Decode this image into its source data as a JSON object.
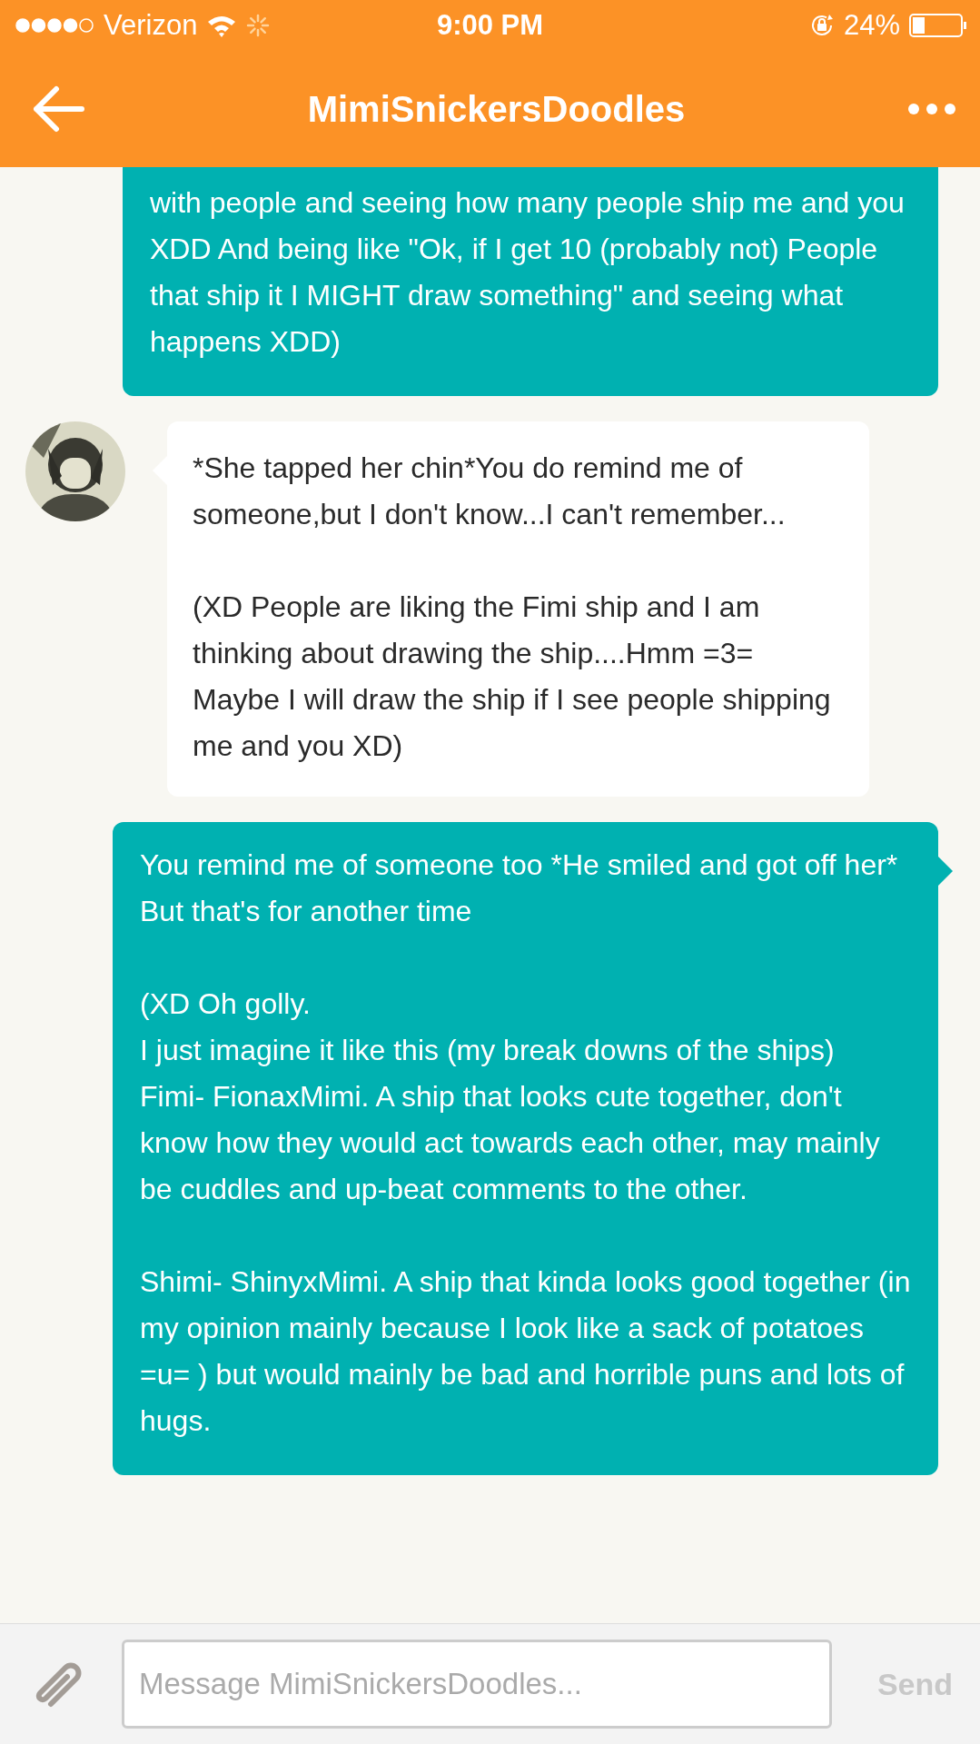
{
  "status_bar": {
    "carrier": "Verizon",
    "time": "9:00 PM",
    "battery": "24%"
  },
  "header": {
    "title": "MimiSnickersDoodles"
  },
  "messages": [
    {
      "kind": "sent",
      "text": "with people and seeing how many people ship me and you XDD And being like \"Ok, if I get 10 (probably not) People that ship it I MIGHT draw something\" and seeing what happens XDD)"
    },
    {
      "kind": "received",
      "text": "*She tapped her chin*You do remind me of someone,but I don't know...I can't remember...\n\n(XD People are liking the Fimi ship and I am thinking about drawing the ship....Hmm =3= Maybe I will draw the ship if I see people shipping me and you XD)"
    },
    {
      "kind": "sent",
      "text": "You remind me of someone too *He smiled and got off her* But that's for another time\n\n(XD Oh golly.\nI just imagine it like this (my break downs of the ships)\nFimi- FionaxMimi. A ship that looks cute together, don't know how they would act towards each other, may mainly be cuddles and up-beat comments to the other.\n\nShimi- ShinyxMimi. A ship that kinda looks good together (in my opinion mainly because I look like a sack of potatoes =u= ) but would mainly be bad and horrible puns and lots of hugs."
    }
  ],
  "composer": {
    "placeholder": "Message MimiSnickersDoodles...",
    "send": "Send"
  }
}
